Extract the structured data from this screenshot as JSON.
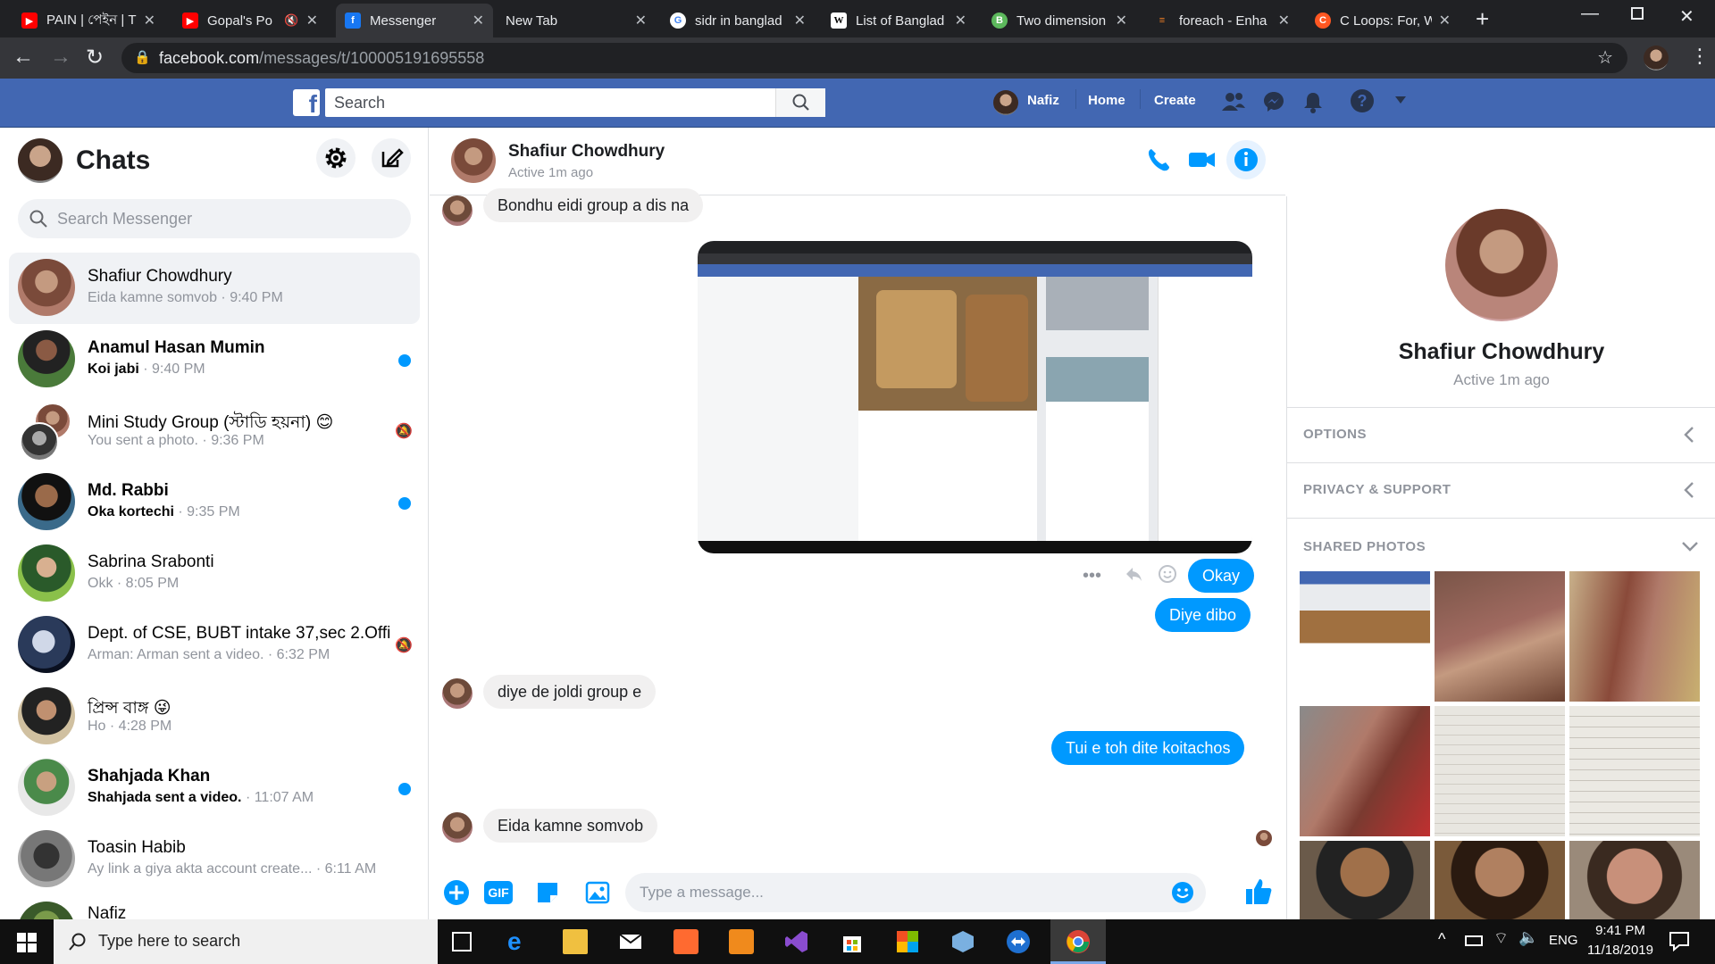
{
  "browser": {
    "tabs": [
      {
        "title": "PAIN | পেইন | T",
        "icon": "youtube-icon",
        "color": "#ff0000"
      },
      {
        "title": "Gopal's Po",
        "icon": "youtube-icon",
        "color": "#ff0000"
      },
      {
        "title": "Messenger",
        "icon": "facebook-icon",
        "color": "#1877f2"
      },
      {
        "title": "New Tab",
        "icon": "",
        "color": ""
      },
      {
        "title": "sidr in banglad",
        "icon": "google-icon",
        "color": "#4285f4"
      },
      {
        "title": "List of Banglad",
        "icon": "wikipedia-icon",
        "color": "#ffffff"
      },
      {
        "title": "Two dimension",
        "icon": "b-icon",
        "color": "#5cb85c"
      },
      {
        "title": "foreach - Enha",
        "icon": "stackoverflow-icon",
        "color": "#f48024"
      },
      {
        "title": "C Loops: For, W",
        "icon": "c-icon",
        "color": "#ff5722"
      }
    ],
    "url_host": "facebook.com",
    "url_path": "/messages/t/100005191695558"
  },
  "fb_header": {
    "search_placeholder": "Search",
    "user_name": "Nafiz",
    "home_label": "Home",
    "create_label": "Create"
  },
  "sidebar": {
    "title": "Chats",
    "search_placeholder": "Search Messenger",
    "chats": [
      {
        "name": "Shafiur Chowdhury",
        "preview": "Eida kamne somvob",
        "time": "9:40 PM",
        "unread": false,
        "muted": false,
        "selected": true
      },
      {
        "name": "Anamul Hasan Mumin",
        "preview": "Koi jabi",
        "time": "9:40 PM",
        "unread": true,
        "muted": false,
        "selected": false
      },
      {
        "name": "Mini Study Group (স্টাডি হয়না) 😊",
        "preview": "You sent a photo.",
        "time": "9:36 PM",
        "unread": false,
        "muted": true,
        "selected": false
      },
      {
        "name": "Md. Rabbi",
        "preview": "Oka kortechi",
        "time": "9:35 PM",
        "unread": true,
        "muted": false,
        "selected": false
      },
      {
        "name": "Sabrina Srabonti",
        "preview": "Okk",
        "time": "8:05 PM",
        "unread": false,
        "muted": false,
        "selected": false
      },
      {
        "name": "Dept. of CSE, BUBT intake 37,sec 2.Offic...",
        "preview": "Arman: Arman sent a video.",
        "time": "6:32 PM",
        "unread": false,
        "muted": true,
        "selected": false
      },
      {
        "name": "প্রিন্স বাঙ্গ 😜",
        "preview": "Ho",
        "time": "4:28 PM",
        "unread": false,
        "muted": false,
        "selected": false
      },
      {
        "name": "Shahjada Khan",
        "preview": "Shahjada sent a video.",
        "time": "11:07 AM",
        "unread": true,
        "muted": false,
        "selected": false
      },
      {
        "name": "Toasin Habib",
        "preview": "Ay link a giya akta account create...",
        "time": "6:11 AM",
        "unread": false,
        "muted": false,
        "selected": false
      },
      {
        "name": "Nafiz",
        "preview": "",
        "time": "",
        "unread": false,
        "muted": false,
        "selected": false
      }
    ]
  },
  "conversation": {
    "contact_name": "Shafiur Chowdhury",
    "status": "Active 1m ago",
    "messages": [
      {
        "text": "Bondhu eidi group a dis na",
        "dir": "in"
      },
      {
        "text": "Okay",
        "dir": "out"
      },
      {
        "text": "Diye dibo",
        "dir": "out"
      },
      {
        "text": "diye de joldi group e",
        "dir": "in"
      },
      {
        "text": "Tui e toh dite koitachos",
        "dir": "out"
      },
      {
        "text": "Eida kamne somvob",
        "dir": "in"
      }
    ],
    "composer_placeholder": "Type a message..."
  },
  "details": {
    "name": "Shafiur Chowdhury",
    "status": "Active 1m ago",
    "options_label": "OPTIONS",
    "privacy_label": "PRIVACY & SUPPORT",
    "shared_photos_label": "SHARED PHOTOS"
  },
  "taskbar": {
    "search_placeholder": "Type here to search",
    "language": "ENG",
    "time": "9:41 PM",
    "date": "11/18/2019"
  }
}
